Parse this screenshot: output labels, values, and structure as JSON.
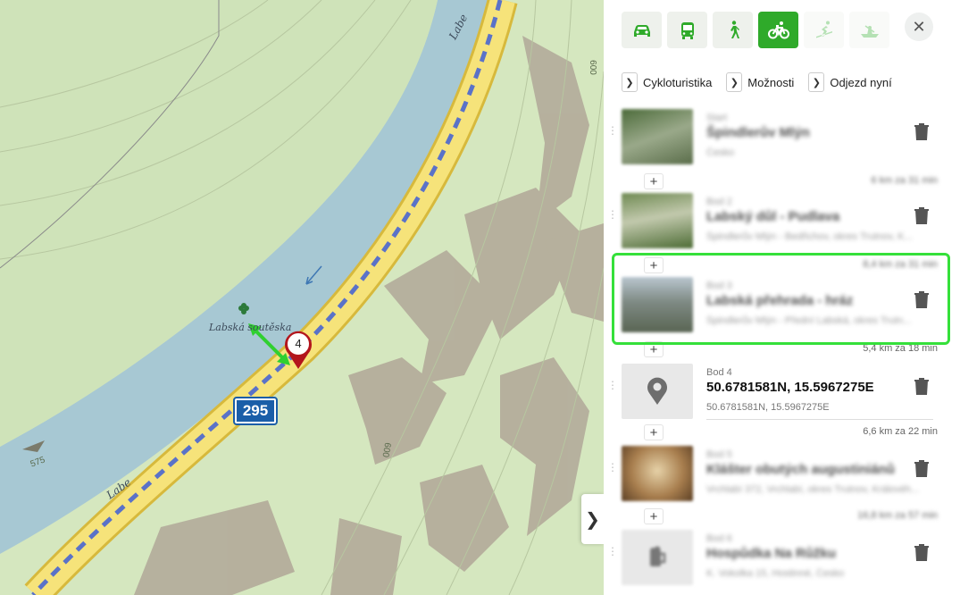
{
  "map": {
    "labels": {
      "river_top": "Labe",
      "river_bottom": "Labe",
      "poi": "Labská soutěska",
      "contour_600_top": "600",
      "contour_600_mid": "600",
      "contour_575": "575"
    },
    "road_number": "295",
    "marker_number": "4",
    "collapse_icon": "chevron-right-icon"
  },
  "panel": {
    "modes": [
      {
        "name": "car",
        "icon": "car-icon",
        "active": false
      },
      {
        "name": "bus",
        "icon": "bus-icon",
        "active": false
      },
      {
        "name": "walk",
        "icon": "walk-icon",
        "active": false
      },
      {
        "name": "bike",
        "icon": "bike-icon",
        "active": true
      },
      {
        "name": "ski",
        "icon": "ski-icon",
        "active": false,
        "disabled": true
      },
      {
        "name": "boat",
        "icon": "boat-icon",
        "active": false,
        "disabled": true
      }
    ],
    "close_icon": "close-icon",
    "options": [
      "Cykloturistika",
      "Možnosti",
      "Odjezd nyní"
    ],
    "waypoints": [
      {
        "kind": "Start",
        "title": "Špindlerův Mlýn",
        "address": "Česko"
      },
      {
        "kind": "Bod 2",
        "title": "Labský důl - Pudlava",
        "address": "Špindlerův Mlýn - Bedřichov, okres Trutnov, K..."
      },
      {
        "kind": "Bod 3",
        "title": "Labská přehrada - hráz",
        "address": "Špindlerův Mlýn - Přední Labská, okres Trutn..."
      },
      {
        "kind": "Bod 4",
        "title": "50.6781581N, 15.5967275E",
        "address": "50.6781581N, 15.5967275E"
      },
      {
        "kind": "Bod 5",
        "title": "Klášter obutých augustiniánů",
        "address": "Vrchlabí 372, Vrchlabí, okres Trutnov, Královéh..."
      },
      {
        "kind": "Bod 6",
        "title": "Hospůdka Na Růžku",
        "address": "K. Vokolka 15, Hostinné, Česko"
      }
    ],
    "segments": [
      {
        "distance": "6 km za 31 min"
      },
      {
        "distance": "8,4 km za 31 min"
      },
      {
        "distance": "5,4 km za 18 min"
      },
      {
        "distance": "6,6 km za 22 min"
      },
      {
        "distance": "16,8 km za 57 min"
      }
    ]
  }
}
